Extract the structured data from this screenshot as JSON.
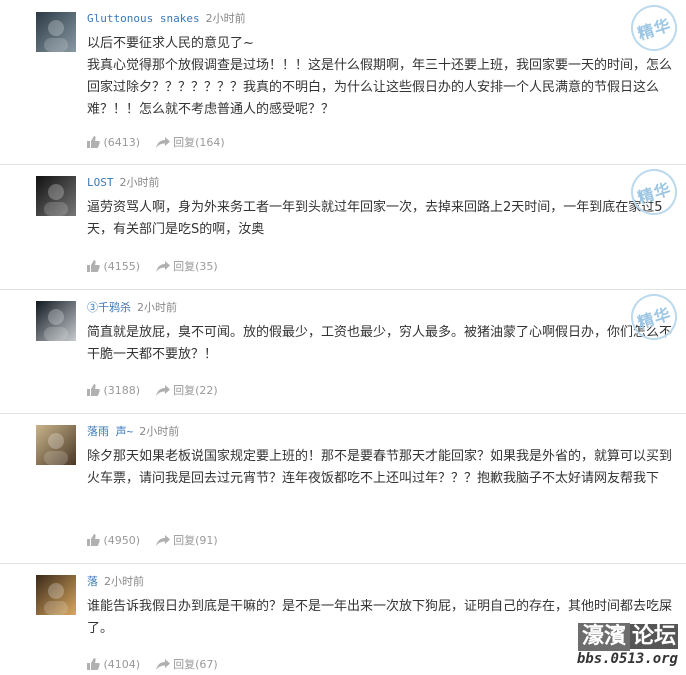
{
  "comments": [
    {
      "user": "Gluttonous snakes",
      "time": "2小时前",
      "text": "以后不要征求人民的意见了~\n我真心觉得那个放假调查是过场！！！这是什么假期啊，年三十还要上班，我回家要一天的时间，怎么回家过除夕？？？？？？？我真的不明白，为什么让这些假日办的人安排一个人民满意的节假日这么难？！！怎么就不考虑普通人的感受呢？？",
      "likes": "(6413)",
      "reply_label": "回复",
      "replies": "(164)",
      "badge": "精华",
      "avatar_colors": [
        "#2b3a45",
        "#8a9aa4"
      ]
    },
    {
      "user": "LOST",
      "time": "2小时前",
      "text": "逼劳资骂人啊，身为外来务工者一年到头就过年回家一次，去掉来回路上2天时间，一年到底在家过5天，有关部门是吃S的啊，汝奥",
      "likes": "(4155)",
      "reply_label": "回复",
      "replies": "(35)",
      "badge": "精华",
      "avatar_colors": [
        "#111111",
        "#777777"
      ]
    },
    {
      "user": "③千鸦杀",
      "time": "2小时前",
      "text": "简直就是放屁，臭不可闻。放的假最少，工资也最少，穷人最多。被猪油蒙了心啊假日办，你们怎么不干脆一天都不要放？！",
      "likes": "(3188)",
      "reply_label": "回复",
      "replies": "(22)",
      "badge": "精华",
      "avatar_colors": [
        "#101820",
        "#c8ccd0"
      ]
    },
    {
      "user": "落雨 声~",
      "time": "2小时前",
      "text": "除夕那天如果老板说国家规定要上班的！那不是要春节那天才能回家？如果我是外省的，就算可以买到火车票，请问我是回去过元宵节？连年夜饭都吃不上还叫过年？？？抱歉我脑子不太好请网友帮我下",
      "likes": "(4950)",
      "reply_label": "回复",
      "replies": "(91)",
      "badge": "",
      "avatar_colors": [
        "#c8b48a",
        "#4a3826"
      ]
    },
    {
      "user": "落",
      "time": "2小时前",
      "text": "谁能告诉我假日办到底是干嘛的？是不是一年出来一次放下狗屁，证明自己的存在，其他时间都去吃屎了。",
      "likes": "(4104)",
      "reply_label": "回复",
      "replies": "(67)",
      "badge": "",
      "avatar_colors": [
        "#3a2a1a",
        "#d9a860"
      ]
    }
  ],
  "watermark": {
    "brand_a": "濠濱",
    "brand_b": "论坛",
    "url": "bbs.0513.org"
  }
}
